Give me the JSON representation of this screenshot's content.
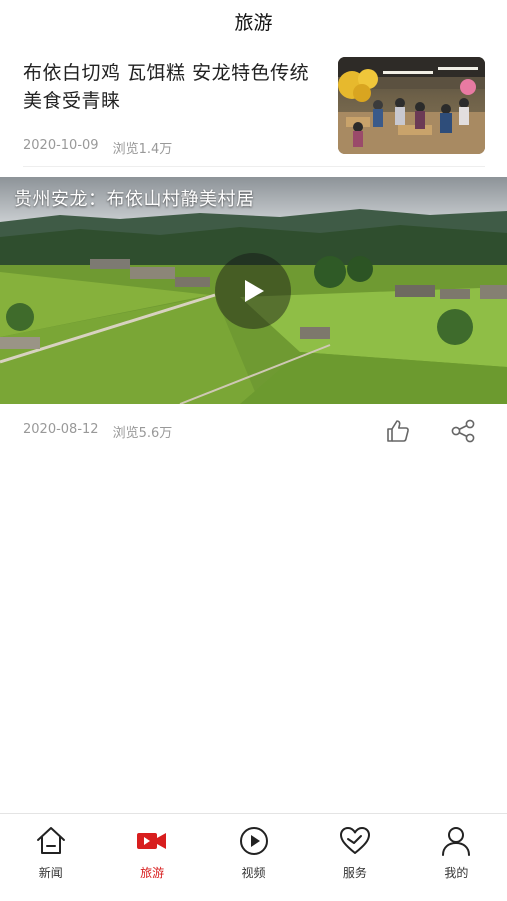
{
  "header": {
    "title": "旅游"
  },
  "article": {
    "title": "布依白切鸡  瓦饵糕  安龙特色传统美食受青睐",
    "date": "2020-10-09",
    "views": "浏览1.4万"
  },
  "video": {
    "title": "贵州安龙：布依山村静美村居",
    "date": "2020-08-12",
    "views": "浏览5.6万"
  },
  "bottom_nav": {
    "items": [
      {
        "label": "新闻",
        "icon": "home-icon"
      },
      {
        "label": "旅游",
        "icon": "video-camera-icon",
        "active": true
      },
      {
        "label": "视频",
        "icon": "play-circle-icon"
      },
      {
        "label": "服务",
        "icon": "heart-icon"
      },
      {
        "label": "我的",
        "icon": "user-icon"
      }
    ]
  },
  "colors": {
    "accent": "#d81e1e",
    "meta": "#999999"
  }
}
